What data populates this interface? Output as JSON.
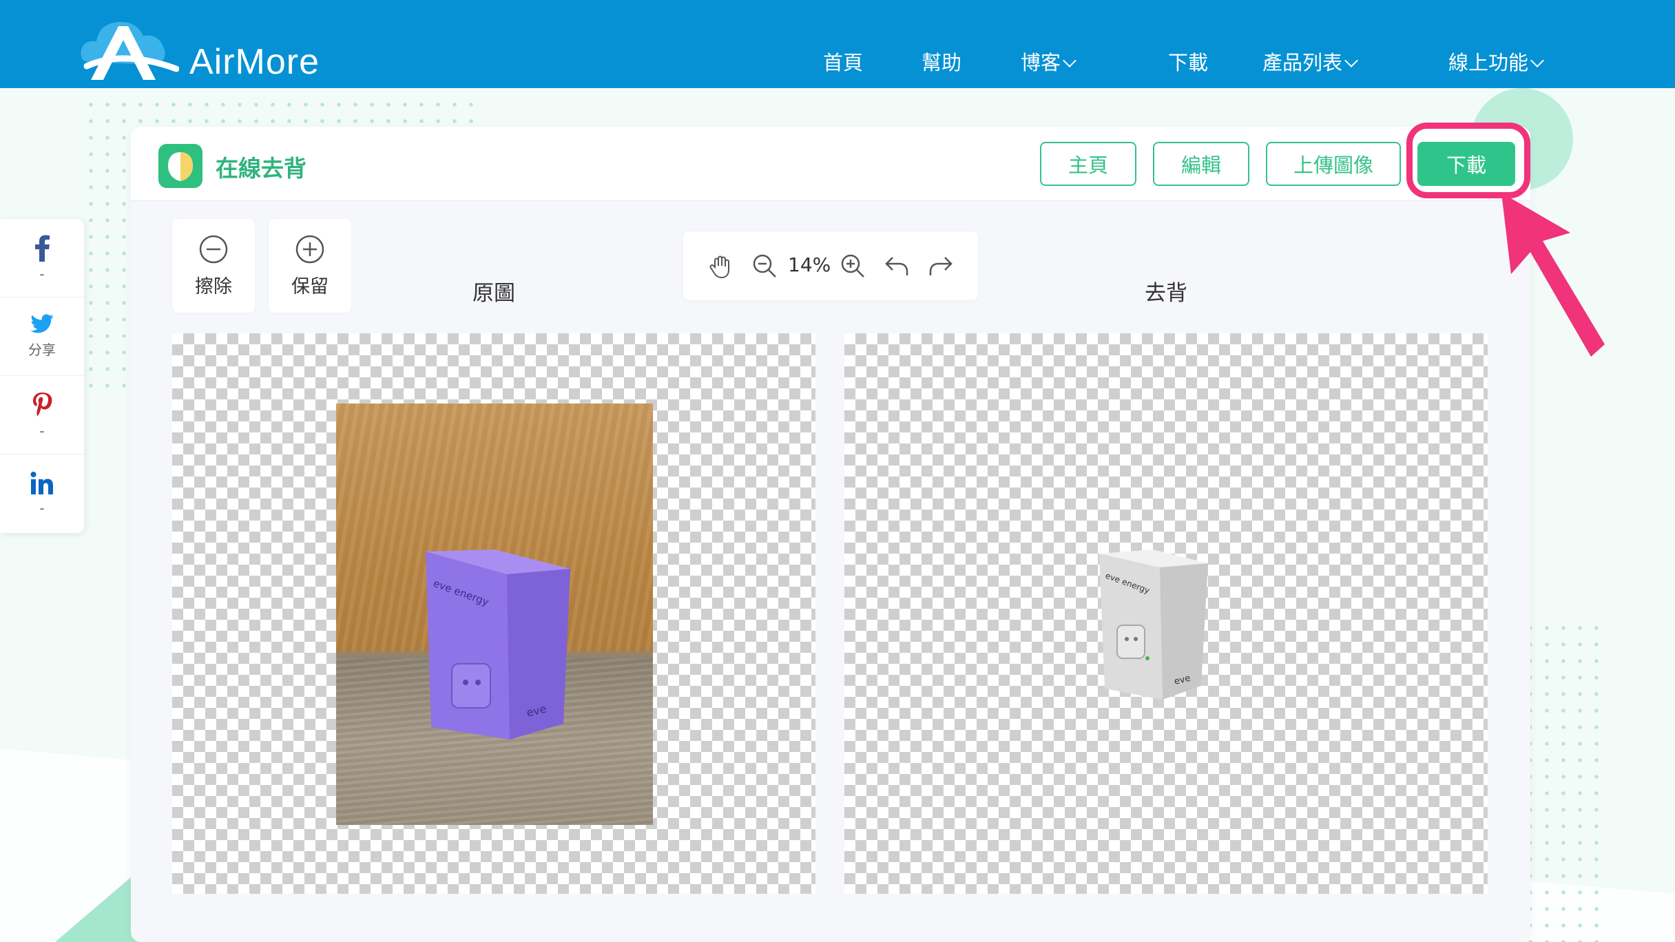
{
  "header": {
    "brand": "AirMore",
    "nav": [
      {
        "label": "首頁",
        "dropdown": false
      },
      {
        "label": "幫助",
        "dropdown": false
      },
      {
        "label": "博客",
        "dropdown": true
      },
      {
        "label": "下載",
        "dropdown": false
      },
      {
        "label": "產品列表",
        "dropdown": true
      },
      {
        "label": "線上功能",
        "dropdown": true
      }
    ]
  },
  "toolbar": {
    "app_title": "在線去背",
    "buttons": {
      "home": "主頁",
      "edit": "編輯",
      "upload": "上傳圖像",
      "download": "下載"
    }
  },
  "tools": {
    "erase": "擦除",
    "keep": "保留",
    "zoom": "14%"
  },
  "columns": {
    "original": "原圖",
    "removed": "去背"
  },
  "product": {
    "brand_text": "eve",
    "product_text": "eve energy"
  },
  "share": {
    "facebook_count": "-",
    "twitter_label": "分享",
    "pinterest_count": "-",
    "linkedin_count": "-"
  },
  "colors": {
    "header": "#0591d4",
    "accent": "#2fc58a",
    "highlight": "#f0337a",
    "box_purple": "#8e74e6"
  }
}
